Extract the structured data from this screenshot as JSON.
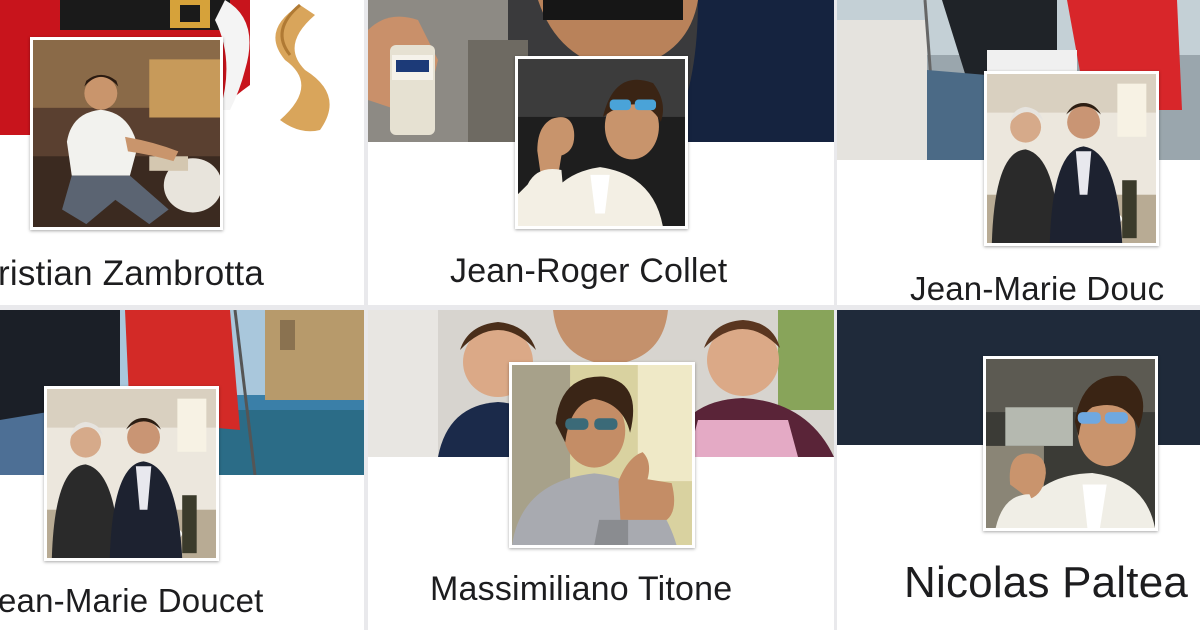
{
  "profiles": [
    {
      "name": "Cristian Zambrotta",
      "shown": "ristian Zambrotta"
    },
    {
      "name": "Jean-Roger Collet",
      "shown": "Jean-Roger Collet"
    },
    {
      "name": "Jean-Marie Doucet",
      "shown": "Jean-Marie Douc"
    },
    {
      "name": "Jean-Marie Doucet",
      "shown": "ean-Marie Doucet"
    },
    {
      "name": "Massimiliano Titone",
      "shown": "Massimiliano Titone"
    },
    {
      "name": "Nicolas Palteau",
      "shown": "Nicolas Paltea"
    }
  ],
  "colors": {
    "background": "#ffffff",
    "card_divider": "#e9e9ec",
    "name_text": "#1d1d1f",
    "santa_red": "#c8141c",
    "night_navy": "#1f2a3a",
    "sea_blue": "#3a7fa8"
  }
}
